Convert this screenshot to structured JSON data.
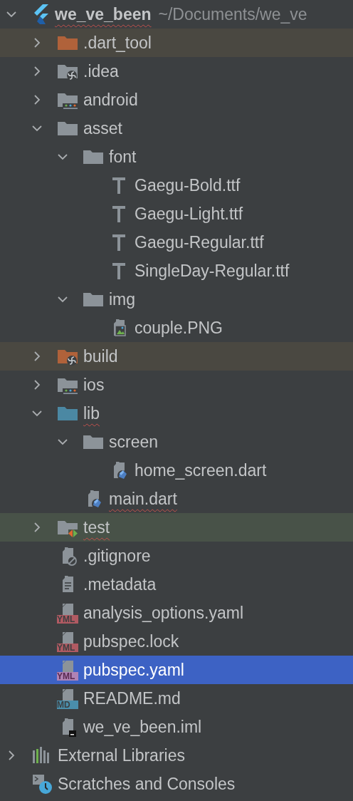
{
  "project": {
    "name": "we_ve_been",
    "path": "~/Documents/we_ve",
    "kind": "flutter",
    "expanded": true,
    "error": true,
    "selected": false,
    "children": [
      {
        "name": ".dart_tool",
        "kind": "folder_excluded",
        "expanded": false,
        "excluded": true,
        "selected": false
      },
      {
        "name": ".idea",
        "kind": "folder_idea",
        "expanded": false,
        "selected": false
      },
      {
        "name": "android",
        "kind": "folder_module",
        "expanded": false,
        "selected": false
      },
      {
        "name": "asset",
        "kind": "folder",
        "expanded": true,
        "selected": false,
        "children": [
          {
            "name": "font",
            "kind": "folder",
            "expanded": true,
            "selected": false,
            "children": [
              {
                "name": "Gaegu-Bold.ttf",
                "kind": "font",
                "selected": false
              },
              {
                "name": "Gaegu-Light.ttf",
                "kind": "font",
                "selected": false
              },
              {
                "name": "Gaegu-Regular.ttf",
                "kind": "font",
                "selected": false
              },
              {
                "name": "SingleDay-Regular.ttf",
                "kind": "font",
                "selected": false
              }
            ]
          },
          {
            "name": "img",
            "kind": "folder",
            "expanded": true,
            "selected": false,
            "children": [
              {
                "name": "couple.PNG",
                "kind": "image",
                "selected": false
              }
            ]
          }
        ]
      },
      {
        "name": "build",
        "kind": "folder_excluded_idea",
        "expanded": false,
        "excluded": true,
        "selected": false
      },
      {
        "name": "ios",
        "kind": "folder_module",
        "expanded": false,
        "selected": false
      },
      {
        "name": "lib",
        "kind": "folder_source",
        "expanded": true,
        "error": true,
        "selected": false,
        "children": [
          {
            "name": "screen",
            "kind": "folder",
            "expanded": true,
            "selected": false,
            "children": [
              {
                "name": "home_screen.dart",
                "kind": "dart",
                "selected": false
              }
            ]
          },
          {
            "name": "main.dart",
            "kind": "dart",
            "error": true,
            "selected": false
          }
        ]
      },
      {
        "name": "test",
        "kind": "folder_test",
        "expanded": false,
        "error": true,
        "test_root": true,
        "selected": false
      },
      {
        "name": ".gitignore",
        "kind": "gitignore",
        "selected": false
      },
      {
        "name": ".metadata",
        "kind": "text",
        "selected": false
      },
      {
        "name": "analysis_options.yaml",
        "kind": "badge",
        "badge": "YML",
        "selected": false
      },
      {
        "name": "pubspec.lock",
        "kind": "badge",
        "badge": "YML",
        "selected": false
      },
      {
        "name": "pubspec.yaml",
        "kind": "badge",
        "badge": "YML",
        "selected": true
      },
      {
        "name": "README.md",
        "kind": "badge",
        "badge": "MD",
        "selected": false
      },
      {
        "name": "we_ve_been.iml",
        "kind": "iml",
        "selected": false
      }
    ]
  },
  "extras": [
    {
      "name": "External Libraries",
      "kind": "libraries",
      "expanded": false,
      "selected": false
    },
    {
      "name": "Scratches and Consoles",
      "kind": "scratches",
      "selected": false
    }
  ]
}
